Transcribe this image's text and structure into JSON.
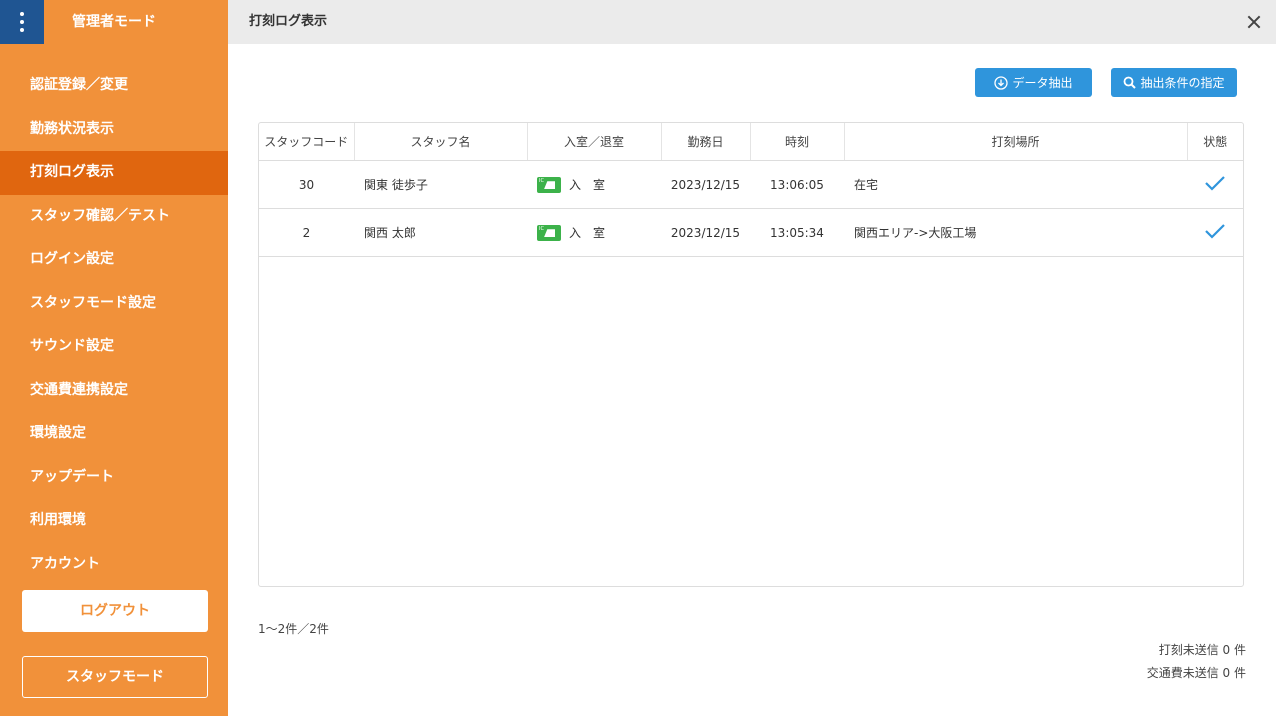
{
  "sidebar": {
    "title": "管理者モード",
    "items": [
      {
        "label": "認証登録／変更"
      },
      {
        "label": "勤務状況表示"
      },
      {
        "label": "打刻ログ表示"
      },
      {
        "label": "スタッフ確認／テスト"
      },
      {
        "label": "ログイン設定"
      },
      {
        "label": "スタッフモード設定"
      },
      {
        "label": "サウンド設定"
      },
      {
        "label": "交通費連携設定"
      },
      {
        "label": "環境設定"
      },
      {
        "label": "アップデート"
      },
      {
        "label": "利用環境"
      },
      {
        "label": "アカウント"
      }
    ],
    "active_item": "打刻ログ表示",
    "logout_label": "ログアウト",
    "staff_mode_label": "スタッフモード"
  },
  "header": {
    "title": "打刻ログ表示"
  },
  "toolbar": {
    "export_label": "データ抽出",
    "filter_label": "抽出条件の指定"
  },
  "table": {
    "columns": [
      "スタッフコード",
      "スタッフ名",
      "入室／退室",
      "勤務日",
      "時刻",
      "打刻場所",
      "状態"
    ],
    "rows": [
      {
        "code": "30",
        "name": "関東 徒歩子",
        "direction": "入　室",
        "date": "2023/12/15",
        "time": "13:06:05",
        "location": "在宅",
        "status": "check-icon"
      },
      {
        "code": "2",
        "name": "関西 太郎",
        "direction": "入　室",
        "date": "2023/12/15",
        "time": "13:05:34",
        "location": "関西エリア->大阪工場",
        "status": "check-icon"
      }
    ]
  },
  "footer": {
    "count_text": "1〜2件／2件",
    "unsent_punch": "打刻未送信 0 件",
    "unsent_transport": "交通費未送信 0 件"
  },
  "colors": {
    "sidebar_bg": "#f1913a",
    "sidebar_active": "#e0660f",
    "menu_button": "#1f5592",
    "button_blue": "#2f95dc",
    "ic_card_green": "#3cb24a",
    "check_blue": "#2f95dc"
  }
}
